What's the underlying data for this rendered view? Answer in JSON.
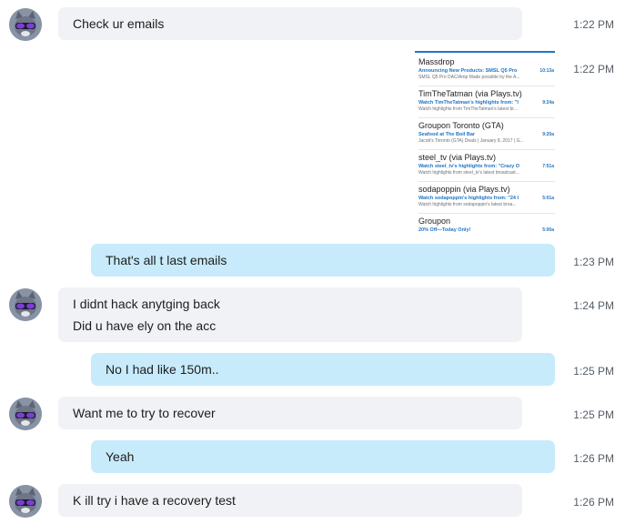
{
  "messages": [
    {
      "text": "Check ur emails",
      "time": "1:22 PM"
    },
    {
      "time": "1:22 PM"
    },
    {
      "text": "That's all t last emails",
      "time": "1:23 PM"
    },
    {
      "line1": "I didnt hack anytging back",
      "line2": "Did u have ely on the acc",
      "time": "1:24 PM"
    },
    {
      "text": "No I had like 150m..",
      "time": "1:25 PM"
    },
    {
      "text": "Want me to try to recover",
      "time": "1:25 PM"
    },
    {
      "text": "Yeah",
      "time": "1:26 PM"
    },
    {
      "text": "K ill try i have a recovery test",
      "time": "1:26 PM"
    }
  ],
  "emails": [
    {
      "sender": "Massdrop",
      "subject": "Announcing New Products: SMSL Q5 Pro",
      "time": "10:13a",
      "preview": "SMSL Q5 Pro DAC/Amp Made possible by the A..."
    },
    {
      "sender": "TimTheTatman (via Plays.tv)",
      "subject": "Watch TimTheTatman's highlights from: \"I",
      "time": "9:24a",
      "preview": "Watch highlights from TimTheTatman's latest br..."
    },
    {
      "sender": "Groupon Toronto (GTA)",
      "subject": "Seafood at The Boil Bar",
      "time": "9:20a",
      "preview": "Jacob's Toronto (GTA) Deals | January 8, 2017 | G..."
    },
    {
      "sender": "steel_tv (via Plays.tv)",
      "subject": "Watch steel_tv's highlights from: \"Crazy O",
      "time": "7:51a",
      "preview": "Watch highlights from steel_tv's latest broadcast..."
    },
    {
      "sender": "sodapoppin (via Plays.tv)",
      "subject": "Watch sodapoppin's highlights from: \"24 I",
      "time": "5:01a",
      "preview": "Watch highlights from sodapoppin's latest broa..."
    },
    {
      "sender": "Groupon",
      "subject": "20% Off—Today Only!",
      "time": "5:00a",
      "preview": ""
    }
  ],
  "colors": {
    "incoming_bubble": "#f1f2f5",
    "outgoing_bubble": "#c7ebfb",
    "accent": "#1e78c8"
  }
}
